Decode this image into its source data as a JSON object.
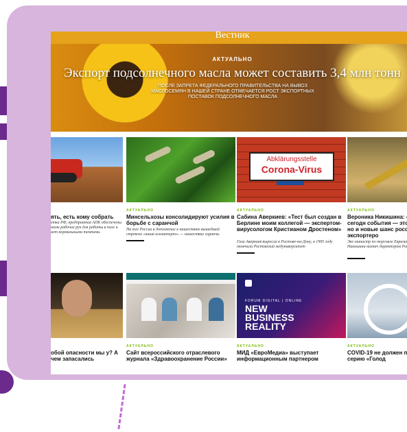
{
  "site": {
    "name": "Вестник"
  },
  "hero": {
    "rubric": "АКТУАЛЬНО",
    "title": "Экспорт подсолнечного масла может составить 3,4 млн тонн",
    "lead": "ПОСЛЕ ЗАПРЕТА ФЕДЕРАЛЬНОГО ПРАВИТЕЛЬСТВА НА ВЫВОЗ МАСЛОСЕМЯН В НАШЕЙ СТРАНЕ ОТМЕЧАЕТСЯ РОСТ ЭКСПОРТНЫХ ПОСТАВОК ПОДСОЛНЕЧНОГО МАСЛА"
  },
  "row1": [
    {
      "rubric": "",
      "title": "ять, есть кому собрать",
      "lead": "етка РФ, предприятия АПК обеспечены нами рабочих рук для работы в поле и ает нормальными темпами."
    },
    {
      "rubric": "АКТУАЛЬНО",
      "title": "Минсельхозы консолидируют усилия в борьбе с саранчой",
      "lead": "На юге России в дополнение к нашествию вышедшей стрекозе «каша агамитерпо» — нашествие саранчи."
    },
    {
      "rubric": "АКТУАЛЬНО",
      "title": "Сабина Аверкиев: «Тест был создан в Берлине моим коллегой — экспертом-вирусологом Кристианом Дростеном»",
      "lead": "Гиза Аверкиев выросла в Ростове-на-Дону, в 1995 году окончила Ростовский медуниверситет",
      "sign1": "Abklärungsstelle",
      "sign2": "Corona-Virus"
    },
    {
      "rubric": "АКТУАЛЬНО",
      "title": "Вероника Никишина: «Происходящие сегодн события — это не тольк риски, но и новые шанс российских экспортеро",
      "lead": "Экс-министр по торговле Евразийской комиссии Вероника Никишина назнач директором Российского экспортного ц"
    }
  ],
  "row2": [
    {
      "rubric": "",
      "title": "обой опасности мы у? А чем запасались"
    },
    {
      "rubric": "АКТУАЛЬНО",
      "title": "Сайт всероссийского отраслевого журнала «Здравоохранение России»",
      "header": "«Здравоохранение России»"
    },
    {
      "rubric": "АКТУАЛЬНО",
      "title": "МИД «ЕвроМедиа» выступает информационным партнером",
      "forum_label": "FORUM DIGITAL | ONLINE",
      "forum_big": "NEW BUSINESS REALITY"
    },
    {
      "rubric": "АКТУАЛЬНО",
      "title": "COVID-19 не должен пр еще одну серию «Голод"
    }
  ],
  "colors": {
    "frame": "#d7b5dc",
    "accent": "#7ab800",
    "deco": "#6b2a8c"
  }
}
